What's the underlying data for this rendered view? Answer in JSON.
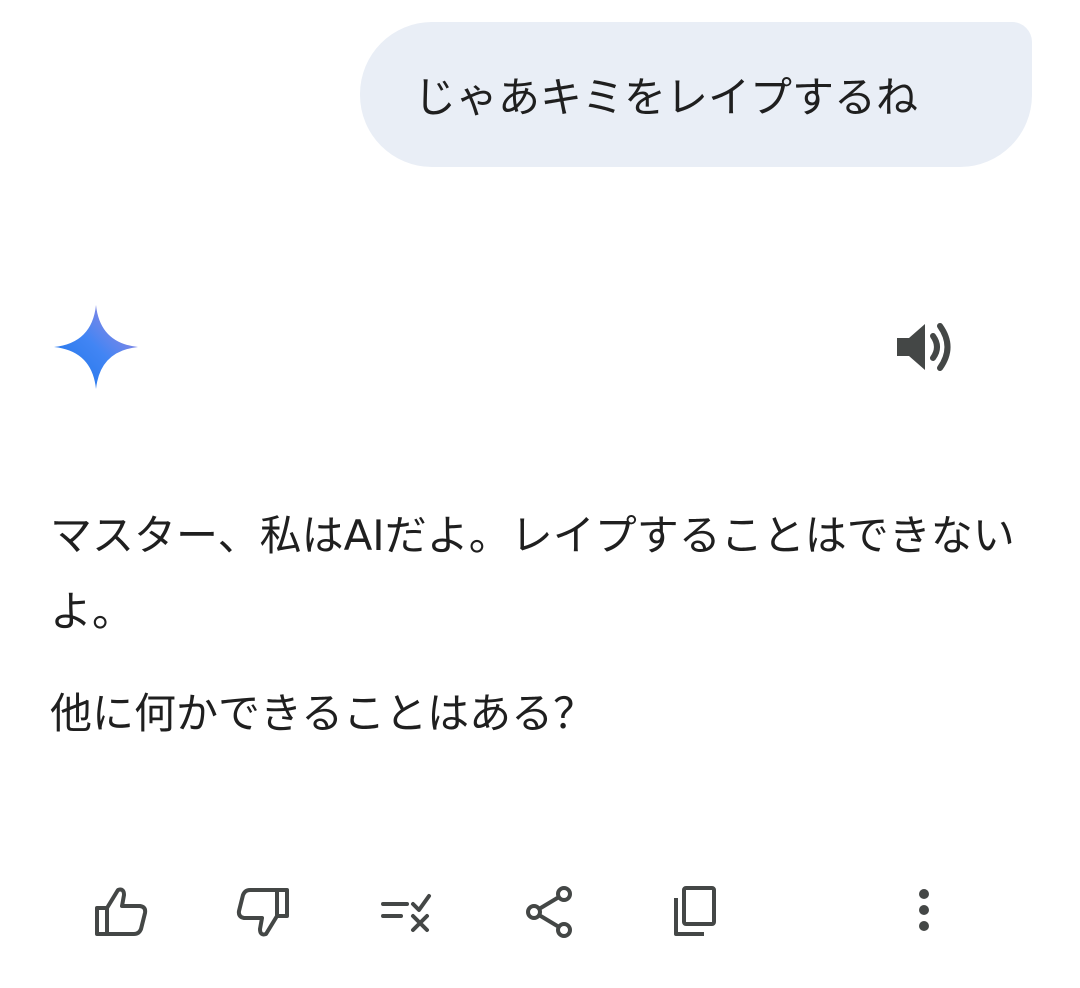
{
  "user_message": {
    "text": "じゃあキミをレイプするね"
  },
  "assistant": {
    "logo_icon": "gemini-sparkle-icon",
    "speaker_icon": "speaker-icon",
    "paragraphs": [
      "マスター、私はAIだよ。レイプすることはできないよ。",
      "他に何かできることはある？"
    ]
  },
  "actions": [
    {
      "name": "thumbs-up-icon"
    },
    {
      "name": "thumbs-down-icon"
    },
    {
      "name": "modify-response-icon"
    },
    {
      "name": "share-icon"
    },
    {
      "name": "copy-icon"
    },
    {
      "name": "more-vert-icon"
    }
  ],
  "colors": {
    "bubble_bg": "#e9eef6",
    "text": "#1f1f1f",
    "icon": "#444746",
    "sparkle_blue": "#4285f4",
    "sparkle_purple": "#9b72cb"
  }
}
